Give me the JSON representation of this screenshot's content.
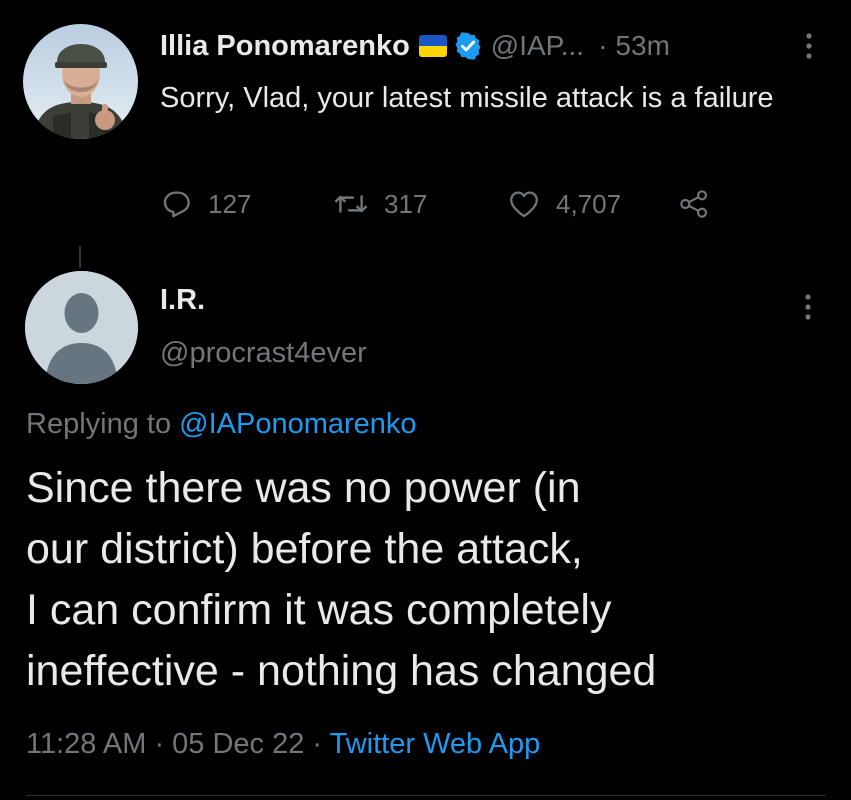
{
  "top_tweet": {
    "display_name": "Illia Ponomarenko",
    "handle": "@IAP...",
    "separator": "·",
    "time_ago": "53m",
    "text": "Sorry, Vlad, your latest missile attack is a failure",
    "flag_colors": {
      "top": "#1a56c4",
      "bottom": "#ffd500"
    },
    "verified_color": "#1d9bf0",
    "actions": {
      "reply_count": "127",
      "retweet_count": "317",
      "like_count": "4,707"
    },
    "icons": [
      "reply-icon",
      "retweet-icon",
      "like-icon",
      "share-icon",
      "more-options-icon",
      "verified-badge-icon"
    ]
  },
  "reply_tweet": {
    "display_name": "I.R.",
    "handle": "@procrast4ever",
    "replying_prefix": "Replying to ",
    "replying_handle": "@IAPonomarenko",
    "text_lines": [
      "Since there was no power (in",
      "our district) before the attack,",
      "I can confirm it was completely",
      "ineffective - nothing has changed"
    ],
    "time": "11:28 AM",
    "date": "05 Dec 22",
    "sep": " · ",
    "source_app": "Twitter Web App"
  },
  "colors": {
    "background": "#000000",
    "primary_text": "#e7e9ea",
    "secondary_text": "#71767b",
    "accent": "#1d9bf0"
  }
}
